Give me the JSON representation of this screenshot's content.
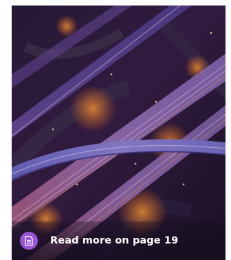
{
  "card": {
    "image_alt": "Aerial night view of a highway interchange",
    "link_icon": "document-icon",
    "link_label": "Read more on page 19",
    "badge_color": "#9a55d6"
  }
}
